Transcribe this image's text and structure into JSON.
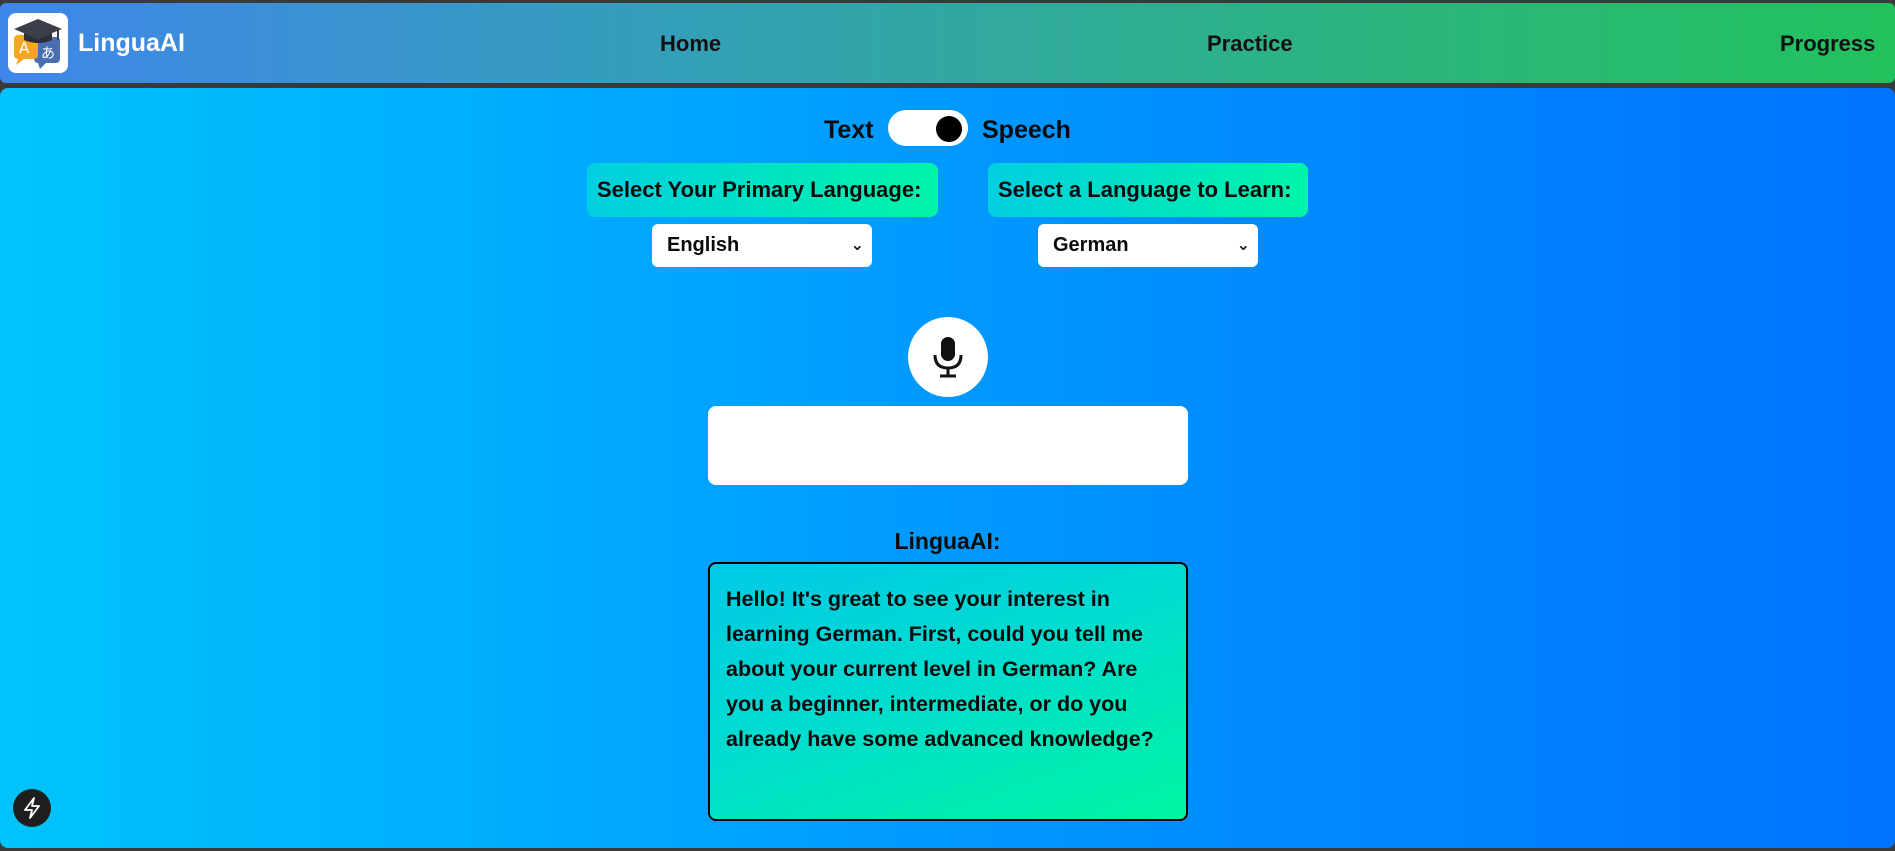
{
  "navbar": {
    "brand": "LinguaAI",
    "links": [
      "Home",
      "Practice",
      "Progress"
    ]
  },
  "mode_toggle": {
    "left_label": "Text",
    "right_label": "Speech",
    "selected": "Speech"
  },
  "language": {
    "primary_label": "Select Your Primary Language:",
    "primary_value": "English",
    "learn_label": "Select a Language to Learn:",
    "learn_value": "German"
  },
  "input": {
    "value": "",
    "placeholder": ""
  },
  "assistant": {
    "label": "LinguaAI:",
    "message": "Hello! It's great to see your interest in learning German. First, could you tell me about your current level in German? Are you a beginner, intermediate, or do you already have some advanced knowledge?"
  },
  "icons": {
    "logo": "graduation-cap-translate-icon",
    "mic": "microphone-icon",
    "bolt": "lightning-bolt-icon"
  },
  "colors": {
    "nav_start": "#3f86ea",
    "nav_end": "#22c25e",
    "main_start": "#00c4fb",
    "main_end": "#0073ff",
    "label_start": "#00cfe0",
    "label_end": "#00f5a8"
  }
}
